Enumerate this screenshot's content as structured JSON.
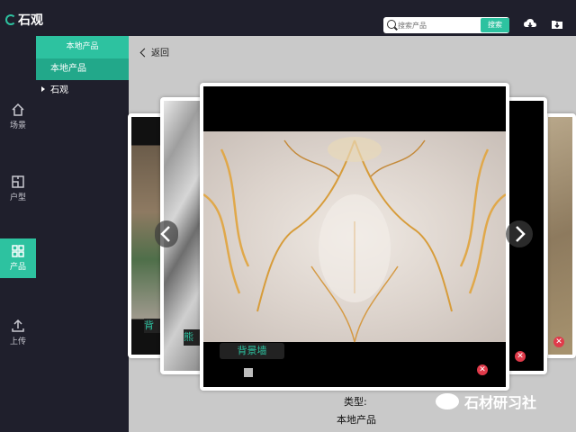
{
  "app": {
    "name": "石观"
  },
  "search": {
    "placeholder": "搜索产品",
    "button": "搜索"
  },
  "sidebar": {
    "items": [
      {
        "label": "场景",
        "icon": "home-icon"
      },
      {
        "label": "户型",
        "icon": "floorplan-icon"
      },
      {
        "label": "产品",
        "icon": "products-icon",
        "active": true
      },
      {
        "label": "上传",
        "icon": "upload-icon"
      }
    ]
  },
  "panel": {
    "header": "本地产品",
    "items": [
      "本地产品",
      "石观"
    ]
  },
  "main": {
    "back": "返回",
    "left_card_label": "背",
    "left_card2_label": "熊",
    "caption": "背景墙",
    "type_label": "类型:",
    "type_value": "本地产品"
  },
  "watermark": {
    "text": "石材研习社"
  },
  "colors": {
    "accent": "#2dc2a0",
    "sidebar_bg": "#1f1f2c",
    "main_bg": "#c9c9c9"
  }
}
